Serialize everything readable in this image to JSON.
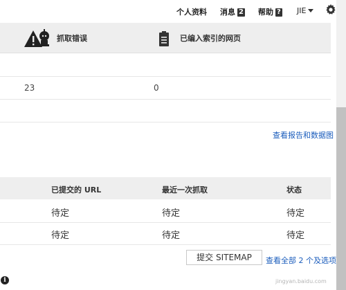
{
  "topnav": {
    "profile_label": "个人资料",
    "messages_label": "消息",
    "messages_count": "2",
    "help_label": "帮助",
    "help_count": "?",
    "user_label": "JIE",
    "settings_icon": "gear-icon"
  },
  "summary": {
    "columns": [
      {
        "label": "抓取错误",
        "icon": "warning-robot-icon"
      },
      {
        "label": "已编入索引的网页",
        "icon": "document-icon"
      }
    ],
    "values": [
      "23",
      "0"
    ],
    "report_link": "查看报告和数据图"
  },
  "sitemaps": {
    "headers": [
      "已提交的 URL",
      "最近一次抓取",
      "状态"
    ],
    "rows": [
      [
        "待定",
        "待定",
        "待定"
      ],
      [
        "待定",
        "待定",
        "待定"
      ]
    ],
    "submit_button": "提交 SITEMAP",
    "view_all_link": "查看全部 2 个及选项"
  },
  "footer": {
    "info_icon": "info-icon",
    "info_glyph": "i"
  },
  "watermark": "jingyan.baidu.com"
}
